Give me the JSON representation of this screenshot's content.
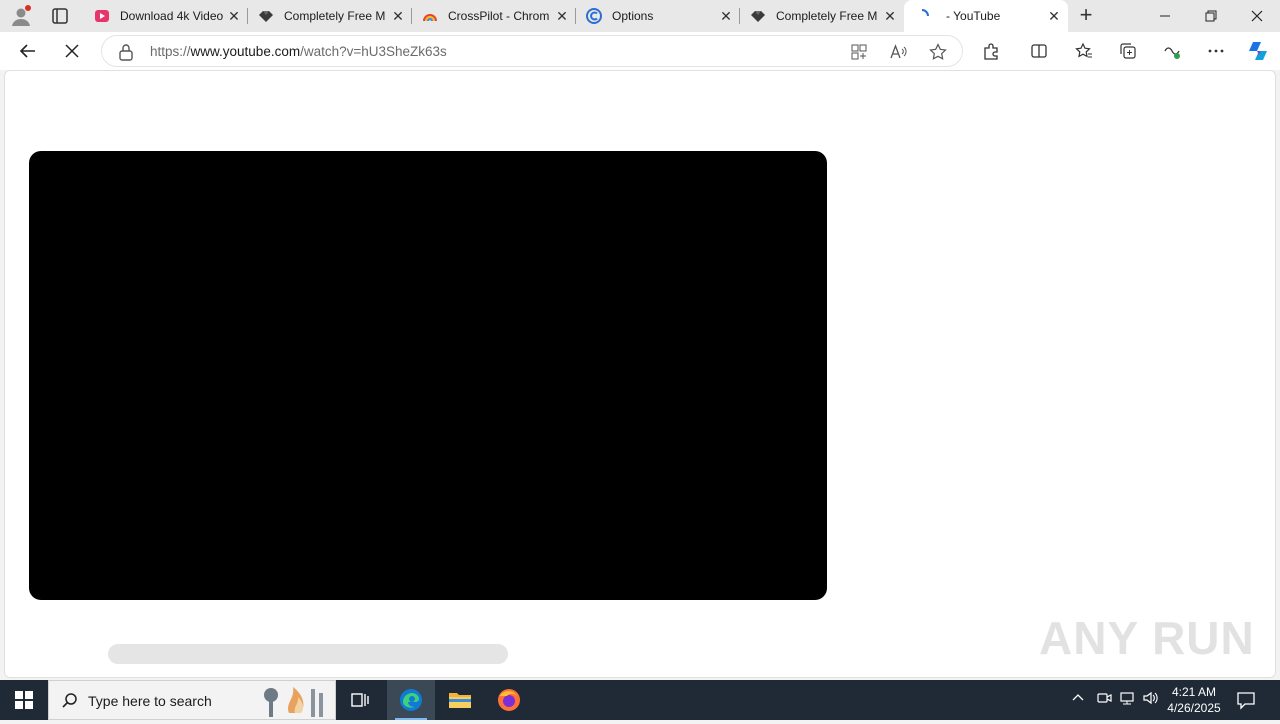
{
  "tabs": [
    {
      "title": "Download 4k Video",
      "favicon": "youtube-download-icon",
      "active": false
    },
    {
      "title": "Completely Free M",
      "favicon": "diamond-logo-icon",
      "active": false
    },
    {
      "title": "CrossPilot - Chrom",
      "favicon": "rainbow-logo-icon",
      "active": false
    },
    {
      "title": "Options",
      "favicon": "options-c-icon",
      "active": false
    },
    {
      "title": "Completely Free M",
      "favicon": "diamond-logo-icon",
      "active": false
    },
    {
      "title": "- YouTube",
      "favicon": "loading-icon",
      "active": true
    }
  ],
  "address_bar": {
    "scheme": "https://",
    "host": "www.youtube.com",
    "path": "/watch?v=hU3SheZk63s"
  },
  "watermark": "ANY RUN",
  "taskbar": {
    "search_placeholder": "Type here to search",
    "time": "4:21 AM",
    "date": "4/26/2025"
  },
  "colors": {
    "taskbar": "#1f2a36",
    "tabbar": "#e8e8e8",
    "player": "#000000",
    "copilot": "#1a73e8"
  }
}
